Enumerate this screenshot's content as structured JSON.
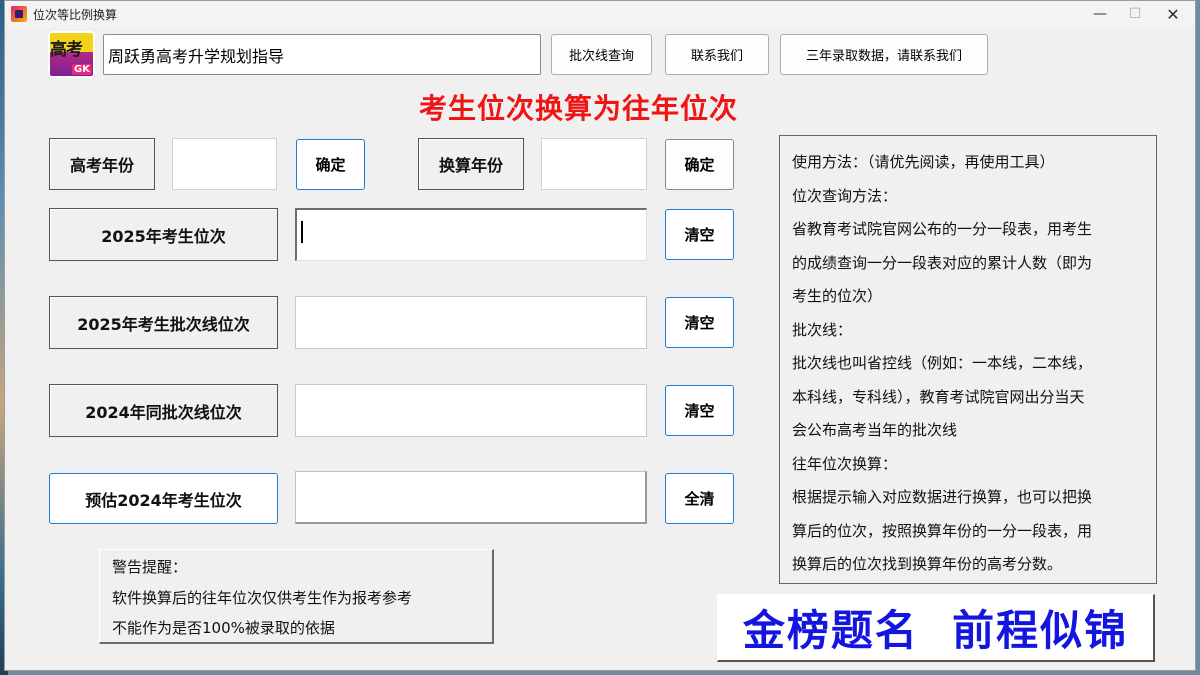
{
  "window": {
    "title": "位次等比例换算"
  },
  "header": {
    "logo_top": "高考",
    "logo_bottom": "GK",
    "title_value": "周跃勇高考升学规划指导",
    "buttons": [
      "批次线查询",
      "联系我们",
      "三年录取数据，请联系我们"
    ]
  },
  "main_title": "考生位次换算为往年位次",
  "year_row": {
    "exam_year_label": "高考年份",
    "exam_year_value": "",
    "confirm1": "确定",
    "convert_year_label": "换算年份",
    "convert_year_value": "",
    "confirm2": "确定"
  },
  "rows": [
    {
      "label": "2025年考生位次",
      "value": "",
      "button": "清空"
    },
    {
      "label": "2025年考生批次线位次",
      "value": "",
      "button": "清空"
    },
    {
      "label": "2024年同批次线位次",
      "value": "",
      "button": "清空"
    },
    {
      "label": "预估2024年考生位次",
      "value": "",
      "button": "全清"
    }
  ],
  "help_lines": [
    "使用方法：（请优先阅读，再使用工具）",
    "位次查询方法：",
    "省教育考试院官网公布的一分一段表，用考生",
    "的成绩查询一分一段表对应的累计人数（即为",
    "考生的位次）",
    "批次线：",
    "批次线也叫省控线（例如：一本线，二本线，",
    "本科线，专科线），教育考试院官网出分当天",
    "会公布高考当年的批次线",
    "往年位次换算：",
    "根据提示输入对应数据进行换算，也可以把换",
    "算后的位次，按照换算年份的一分一段表，用",
    "换算后的位次找到换算年份的高考分数。"
  ],
  "warning_lines": [
    "警告提醒：",
    "软件换算后的往年位次仅供考生作为报考参考",
    "不能作为是否100%被录取的依据"
  ],
  "slogan": "金榜题名  前程似锦"
}
